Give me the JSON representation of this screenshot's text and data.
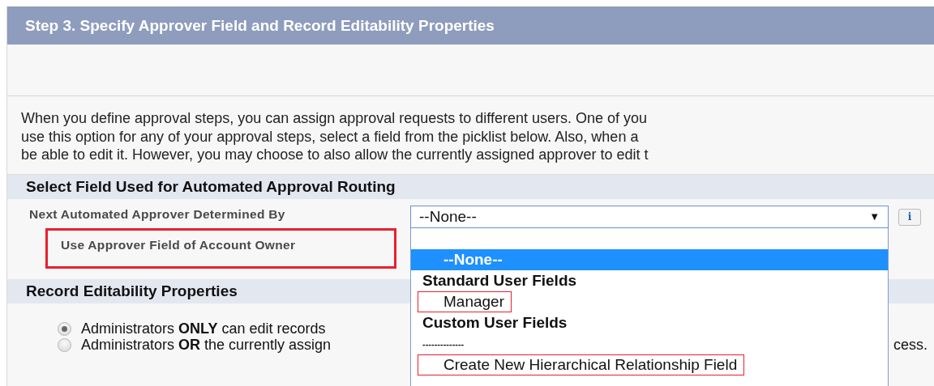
{
  "header": {
    "title": "Step 3. Specify Approver Field and Record Editability Properties"
  },
  "intro": {
    "lines": [
      "When you define approval steps, you can assign approval requests to different users. One of you",
      "use this option for any of your approval steps, select a field from the picklist below. Also, when a",
      "be able to edit it. However, you may choose to also allow the currently assigned approver to edit t"
    ]
  },
  "routing": {
    "title": "Select Field Used for Automated Approval Routing",
    "field_label": "Next Automated Approver Determined By",
    "option_label": "Use Approver Field of Account Owner",
    "option_highlighted": true,
    "select": {
      "value": "--None--",
      "arrow": "▼",
      "expanded": true,
      "options": [
        {
          "kind": "option",
          "label": "--None--",
          "selected": true,
          "highlighted": false
        },
        {
          "kind": "group",
          "label": "Standard User Fields"
        },
        {
          "kind": "option",
          "label": "Manager",
          "selected": false,
          "highlighted": true
        },
        {
          "kind": "group",
          "label": "Custom User Fields"
        },
        {
          "kind": "separator",
          "label": "--------------"
        },
        {
          "kind": "option",
          "label": "Create New Hierarchical Relationship Field",
          "selected": false,
          "highlighted": true
        }
      ]
    },
    "info": "i"
  },
  "editability": {
    "title": "Record Editability Properties",
    "options": [
      {
        "label": "Administrators **ONLY** can edit records",
        "selected": true
      },
      {
        "label": "Administrators **OR** the currently assign",
        "trailing": "cess.",
        "selected": false
      }
    ]
  }
}
